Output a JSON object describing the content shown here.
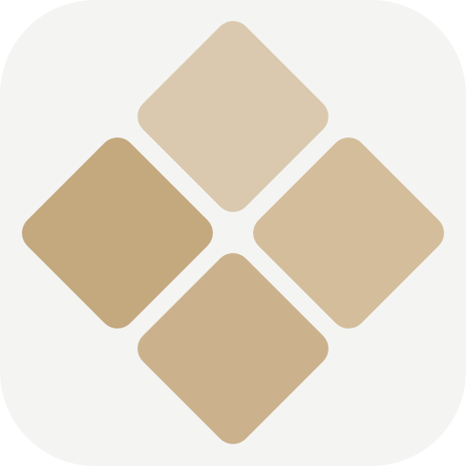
{
  "icon": {
    "name": "four-diamond-tile-app-icon",
    "colors": {
      "page_background": "#ffffff",
      "icon_background": "#f4f4f3",
      "tile_top": "#dac9ae",
      "tile_left": "#c4a87e",
      "tile_right": "#d4bd9b",
      "tile_bottom": "#cbb28d"
    }
  }
}
